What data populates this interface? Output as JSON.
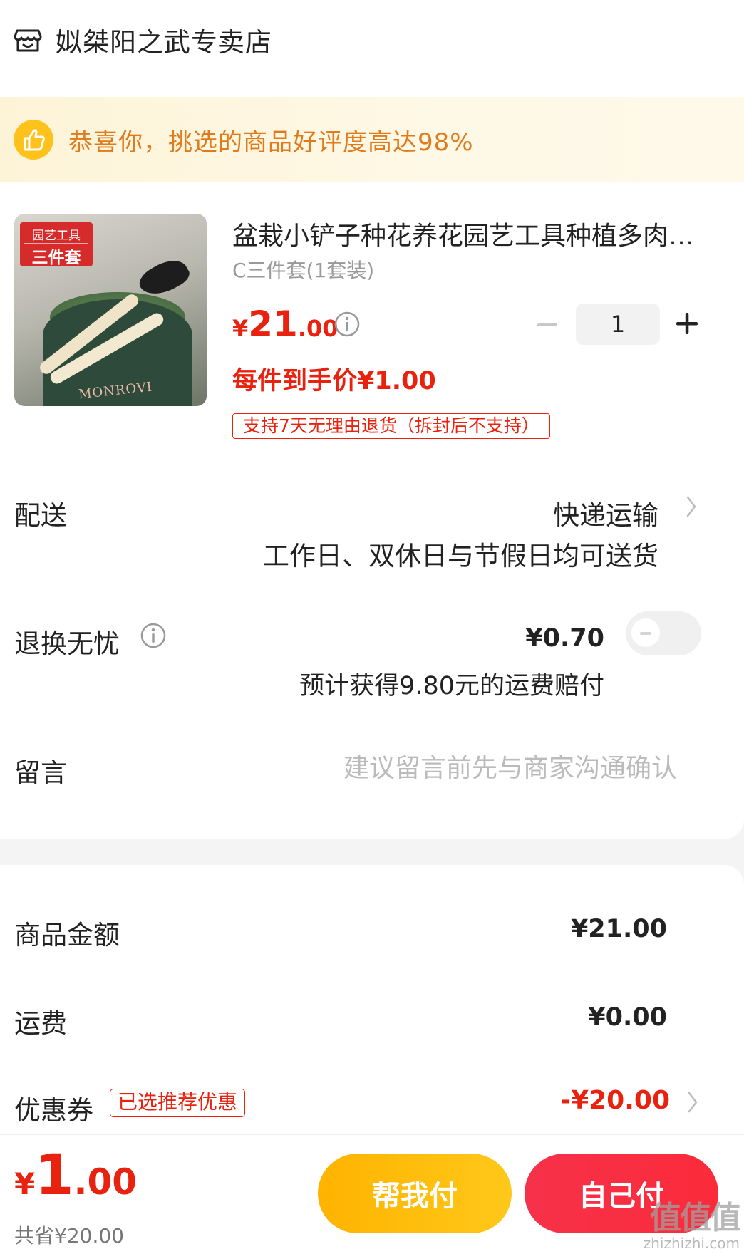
{
  "shop": {
    "name": "姒桀阳之武专卖店",
    "icon": "store-icon"
  },
  "banner": {
    "text": "恭喜你，挑选的商品好评度高达98%",
    "icon": "thumbs-up-icon"
  },
  "product": {
    "image_label_line1": "园艺工具",
    "image_label_line2": "三件套",
    "image_brand": "MONROVI",
    "title": "盆栽小铲子种花养花园艺工具种植多肉三件套家用花铲子",
    "spec": "C三件套(1套装)",
    "price_currency": "¥",
    "price_int": "21",
    "price_dec": ".00",
    "unit_price": "每件到手价¥1.00",
    "return_tag": "支持7天无理由退货（拆封后不支持）",
    "quantity": "1"
  },
  "delivery": {
    "label": "配送",
    "value": "快递运输",
    "sub": "工作日、双休日与节假日均可送货"
  },
  "worry_free": {
    "label": "退换无忧",
    "price": "¥0.70",
    "sub": "预计获得9.80元的运费赔付",
    "toggle_on": false
  },
  "message": {
    "label": "留言",
    "placeholder": "建议留言前先与商家沟通确认"
  },
  "summary": {
    "goods_label": "商品金额",
    "goods_value": "¥21.00",
    "shipping_label": "运费",
    "shipping_value": "¥0.00",
    "coupon_label": "优惠券",
    "coupon_tag": "已选推荐优惠",
    "coupon_value": "-¥20.00"
  },
  "footer": {
    "total_currency": "¥",
    "total_int": "1",
    "total_dec": ".00",
    "saved": "共省¥20.00",
    "help_pay": "帮我付",
    "self_pay": "自己付"
  },
  "watermark": {
    "main": "值值值",
    "sub": "zhizhizhi.com"
  },
  "colors": {
    "accent_red": "#e8220e",
    "banner_text": "#e07a1b",
    "help_btn": "#ffb300",
    "self_btn": "#f6314a"
  }
}
